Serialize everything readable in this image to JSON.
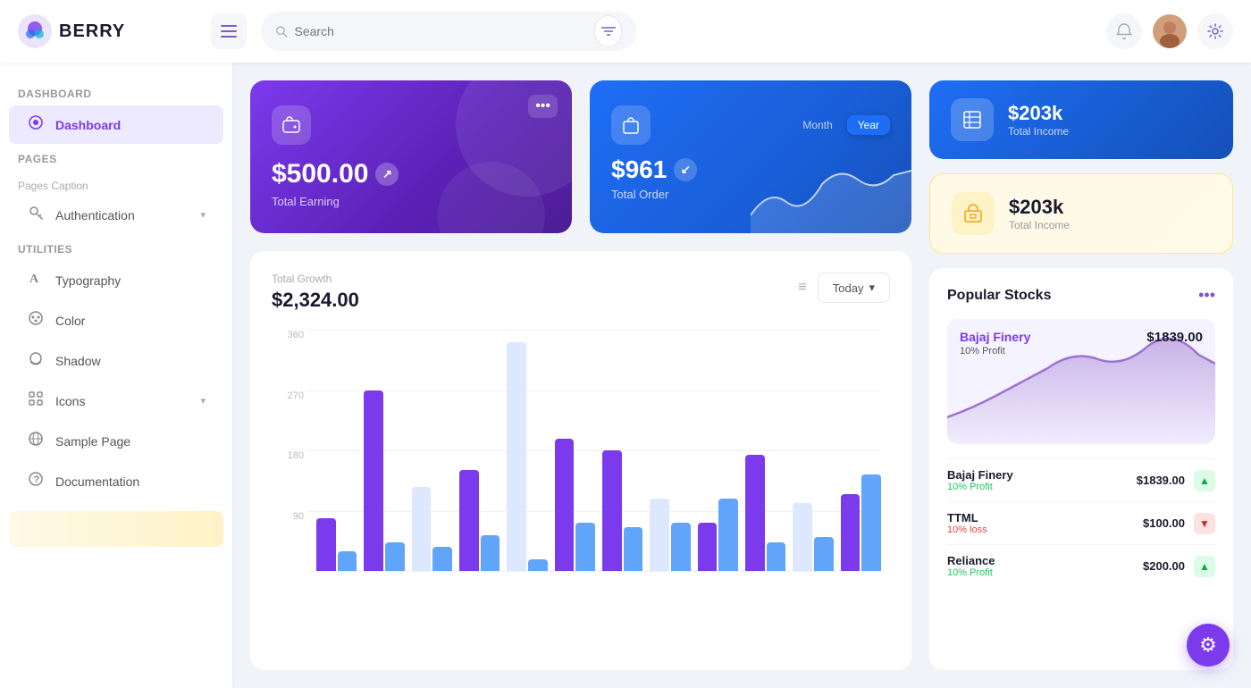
{
  "header": {
    "logo_text": "BERRY",
    "search_placeholder": "Search",
    "hamburger_label": "☰"
  },
  "sidebar": {
    "dashboard_section": "Dashboard",
    "dashboard_item": "Dashboard",
    "pages_section": "Pages",
    "pages_caption": "Pages Caption",
    "authentication_label": "Authentication",
    "utilities_section": "Utilities",
    "typography_label": "Typography",
    "color_label": "Color",
    "shadow_label": "Shadow",
    "icons_label": "Icons",
    "sample_page_label": "Sample Page",
    "documentation_label": "Documentation"
  },
  "cards": {
    "card1_amount": "$500.00",
    "card1_label": "Total Earning",
    "card2_amount": "$961",
    "card2_label": "Total Order",
    "card2_tab_month": "Month",
    "card2_tab_year": "Year",
    "right1_amount": "$203k",
    "right1_label": "Total Income",
    "right2_amount": "$203k",
    "right2_label": "Total Income"
  },
  "growth": {
    "title": "Total Growth",
    "amount": "$2,324.00",
    "button_label": "Today",
    "y_labels": [
      "360",
      "270",
      "180",
      "90"
    ],
    "menu_icon": "≡"
  },
  "stocks": {
    "title": "Popular Stocks",
    "chart_stock_name": "Bajaj Finery",
    "chart_stock_profit": "10% Profit",
    "chart_stock_price": "$1839.00",
    "more_icon": "•••",
    "items": [
      {
        "name": "Bajaj Finery",
        "sub": "10% Profit",
        "sub_type": "profit",
        "price": "$1839.00",
        "trend": "up"
      },
      {
        "name": "TTML",
        "sub": "10% loss",
        "sub_type": "loss",
        "price": "$100.00",
        "trend": "down"
      },
      {
        "name": "Reliance",
        "sub": "10% Profit",
        "sub_type": "profit",
        "price": "$200.00",
        "trend": "up"
      }
    ]
  },
  "floating": {
    "settings_icon": "⚙"
  }
}
